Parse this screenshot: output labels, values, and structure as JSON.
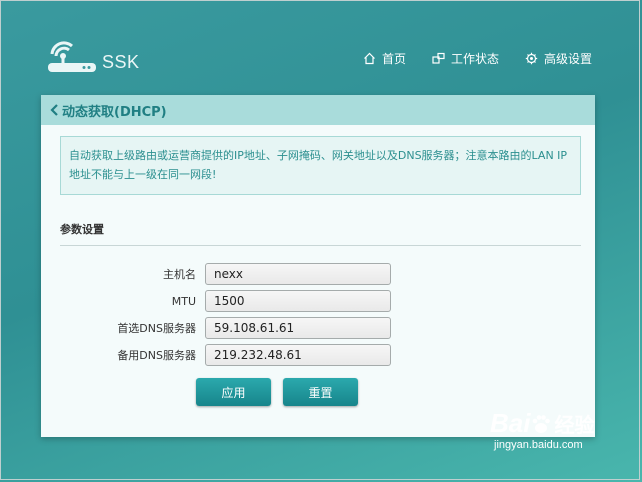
{
  "header": {
    "brand": "SSK",
    "nav": [
      {
        "label": "首页",
        "icon": "home-icon"
      },
      {
        "label": "工作状态",
        "icon": "status-icon"
      },
      {
        "label": "高级设置",
        "icon": "gear-icon"
      }
    ]
  },
  "panel": {
    "title": "动态获取(DHCP)",
    "notice": "自动获取上级路由或运营商提供的IP地址、子网掩码、网关地址以及DNS服务器；注意本路由的LAN IP地址不能与上一级在同一网段!",
    "section_title": "参数设置",
    "fields": [
      {
        "label": "主机名",
        "value": "nexx"
      },
      {
        "label": "MTU",
        "value": "1500"
      },
      {
        "label": "首选DNS服务器",
        "value": "59.108.61.61"
      },
      {
        "label": "备用DNS服务器",
        "value": "219.232.48.61"
      }
    ],
    "apply_label": "应用",
    "reset_label": "重置"
  },
  "watermark": {
    "brand": "Bai",
    "brand_suffix": "经验",
    "url": "jingyan.baidu.com"
  },
  "colors": {
    "background": "#3a9a9f",
    "header_bar": "#a9dcdb",
    "accent": "#207f83",
    "button": "#1f979c"
  }
}
